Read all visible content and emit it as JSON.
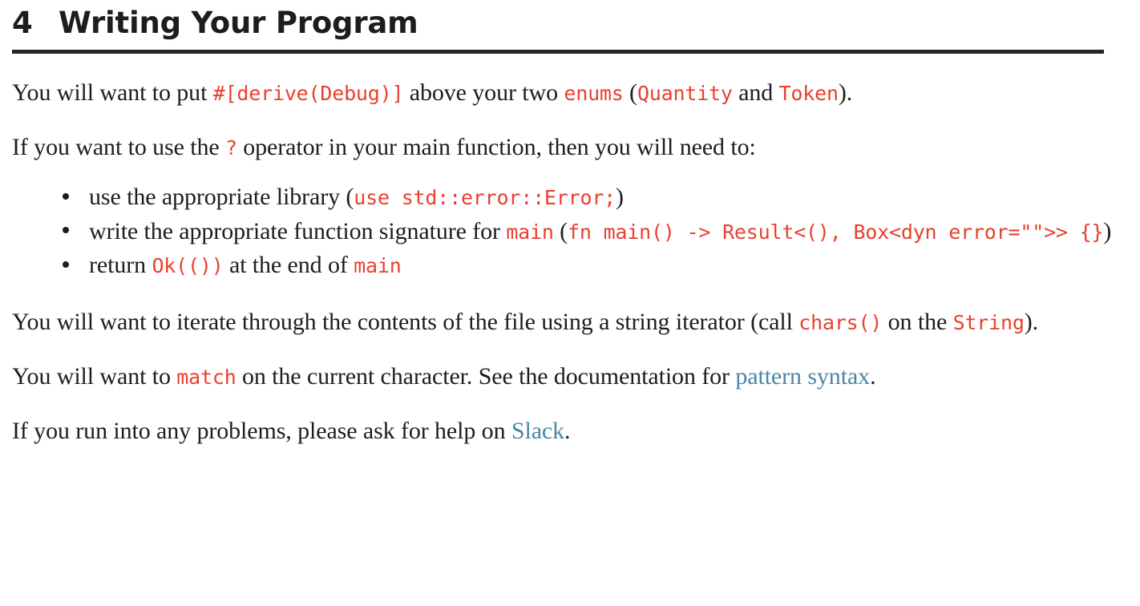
{
  "heading": {
    "number": "4",
    "title": "Writing Your Program"
  },
  "paragraphs": {
    "derive": {
      "part1": "You will want to put ",
      "code1": "#[derive(Debug)]",
      "part2": " above your two ",
      "code2": "enums",
      "part3": " (",
      "code3": "Quantity",
      "part4": " and ",
      "code4": "Token",
      "part5": ")."
    },
    "question_op": {
      "part1": "If you want to use the ",
      "code1": "?",
      "part2": " operator in your main function, then you will need to:"
    },
    "iterate": {
      "part1": "You will want to iterate through the contents of the file using a string iterator (call ",
      "code1": "chars()",
      "part2": " on the ",
      "code2": "String",
      "part3": ")."
    },
    "match": {
      "part1": "You will want to ",
      "code1": "match",
      "part2": " on the current character. See the documentation for ",
      "link1": "pattern syntax",
      "part3": "."
    },
    "help": {
      "part1": "If you run into any problems, please ask for help on ",
      "link1": "Slack",
      "part2": "."
    }
  },
  "bullets": [
    {
      "part1": "use the appropriate library (",
      "code1": "use std::error::Error;",
      "part2": ")"
    },
    {
      "part1": "write the appropriate function signature for ",
      "code1": "main",
      "part2": " (",
      "code2": "fn main() -> Result<(), Box<dyn error=\"\">> {}",
      "part3": ")"
    },
    {
      "part1": "return ",
      "code1": "Ok(())",
      "part2": " at the end of ",
      "code2": "main"
    }
  ],
  "colors": {
    "code_red": "#e8412e",
    "link_blue": "#4a86a8",
    "text": "#1d1d1d",
    "rule": "#262626"
  }
}
